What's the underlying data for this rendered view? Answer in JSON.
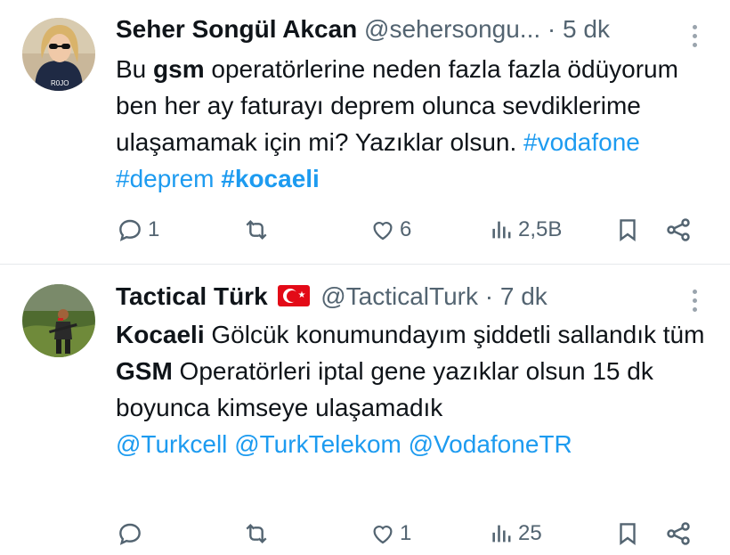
{
  "tweets": [
    {
      "name": "Seher Songül Akcan",
      "handle": "@sehersongu...",
      "dot": "·",
      "time": "5 dk",
      "text_parts": [
        {
          "t": "Bu ",
          "k": "plain"
        },
        {
          "t": "gsm",
          "k": "bold"
        },
        {
          "t": " operatörlerine neden fazla fazla ödüyorum ben her ay faturayı deprem olunca sevdiklerime ulaşamamak için mi? Yazıklar olsun. ",
          "k": "plain"
        },
        {
          "t": "#vodafone",
          "k": "hashtag"
        },
        {
          "t": " ",
          "k": "plain"
        },
        {
          "t": "#deprem",
          "k": "hashtag"
        },
        {
          "t": " ",
          "k": "plain"
        },
        {
          "t": "#kocaeli",
          "k": "hashtag-bold"
        }
      ],
      "actions": {
        "reply": "1",
        "retweet": "",
        "like": "6",
        "views": "2,5B"
      }
    },
    {
      "name": "Tactical Türk",
      "handle": "@TacticalTurk",
      "dot": "·",
      "time": "7 dk",
      "text_parts": [
        {
          "t": "Kocaeli",
          "k": "bold"
        },
        {
          "t": " Gölcük konumundayım şiddetli sallandık tüm ",
          "k": "plain"
        },
        {
          "t": "GSM",
          "k": "bold"
        },
        {
          "t": " Operatörleri iptal gene yazıklar olsun 15 dk boyunca kimseye ulaşamadık",
          "k": "plain"
        },
        {
          "t": "\n",
          "k": "break"
        },
        {
          "t": "@Turkcell",
          "k": "mention"
        },
        {
          "t": " ",
          "k": "plain"
        },
        {
          "t": "@TurkTelekom",
          "k": "mention"
        },
        {
          "t": " ",
          "k": "plain"
        },
        {
          "t": "@VodafoneTR",
          "k": "mention"
        }
      ],
      "actions": {
        "reply": "",
        "retweet": "",
        "like": "1",
        "views": "25"
      }
    }
  ],
  "colors": {
    "link": "#1d9bf0",
    "muted": "#536471",
    "flag": "#e30a17"
  },
  "icons": [
    "reply-icon",
    "retweet-icon",
    "like-icon",
    "views-icon",
    "bookmark-icon",
    "share-icon",
    "more-icon",
    "turkey-flag-icon"
  ]
}
